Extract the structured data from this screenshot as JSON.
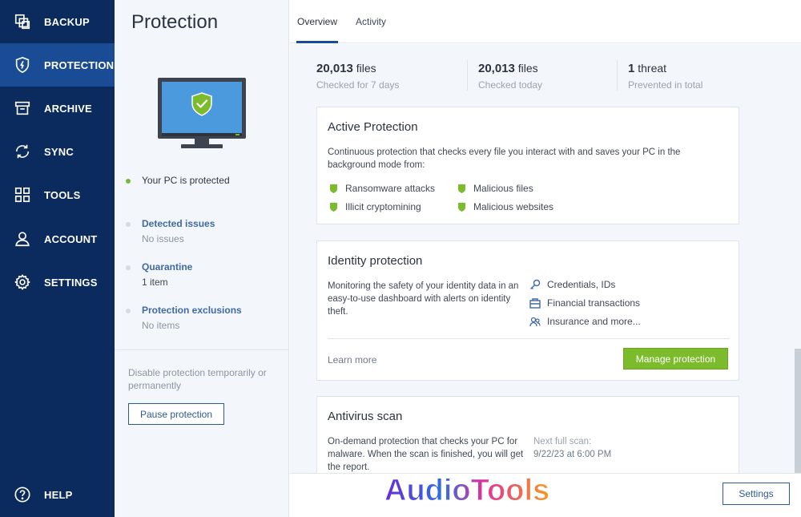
{
  "sidebar": {
    "items": [
      {
        "label": "BACKUP",
        "icon": "backup-icon"
      },
      {
        "label": "PROTECTION",
        "icon": "shield-icon",
        "active": true
      },
      {
        "label": "ARCHIVE",
        "icon": "archive-icon"
      },
      {
        "label": "SYNC",
        "icon": "sync-icon"
      },
      {
        "label": "TOOLS",
        "icon": "tools-grid-icon"
      },
      {
        "label": "ACCOUNT",
        "icon": "account-icon"
      },
      {
        "label": "SETTINGS",
        "icon": "gear-icon"
      }
    ],
    "help": {
      "label": "HELP",
      "icon": "help-icon"
    }
  },
  "panel": {
    "title": "Protection",
    "status": "Your PC is protected",
    "items": [
      {
        "label": "Detected issues",
        "value": "No issues"
      },
      {
        "label": "Quarantine",
        "value": "1 item"
      },
      {
        "label": "Protection exclusions",
        "value": "No items"
      }
    ],
    "note": "Disable protection temporarily or permanently",
    "pause_button": "Pause protection"
  },
  "tabs": [
    {
      "label": "Overview",
      "active": true
    },
    {
      "label": "Activity"
    }
  ],
  "stats": [
    {
      "number": "20,013",
      "unit": "files",
      "label": "Checked for 7 days"
    },
    {
      "number": "20,013",
      "unit": "files",
      "label": "Checked today"
    },
    {
      "number": "1",
      "unit": "threat",
      "label": "Prevented in total"
    }
  ],
  "active_protection": {
    "title": "Active Protection",
    "description": "Continuous protection that checks every file you interact with and saves your PC in the background mode from:",
    "features": [
      "Ransomware attacks",
      "Malicious files",
      "Illicit cryptomining",
      "Malicious websites"
    ]
  },
  "identity_protection": {
    "title": "Identity protection",
    "description": "Monitoring the safety of your identity data in an easy-to-use dashboard with alerts on identity theft.",
    "features": [
      {
        "label": "Credentials, IDs",
        "icon": "key-icon"
      },
      {
        "label": "Financial transactions",
        "icon": "wallet-icon"
      },
      {
        "label": "Insurance and more...",
        "icon": "people-icon"
      }
    ],
    "learn_more": "Learn more",
    "manage_button": "Manage protection"
  },
  "antivirus": {
    "title": "Antivirus scan",
    "description": "On-demand protection that checks your PC for malware. When the scan is finished, you will get the report.",
    "next_scan_label": "Next full scan:",
    "next_scan_value": "9/22/23 at 6:00 PM"
  },
  "settings_button": "Settings",
  "watermark": "AudioTools",
  "colors": {
    "sidebar": "#0b2a5e",
    "sidebar_active": "#1a4c95",
    "accent_green": "#7cbb2c",
    "link_blue": "#3e6aa6"
  }
}
